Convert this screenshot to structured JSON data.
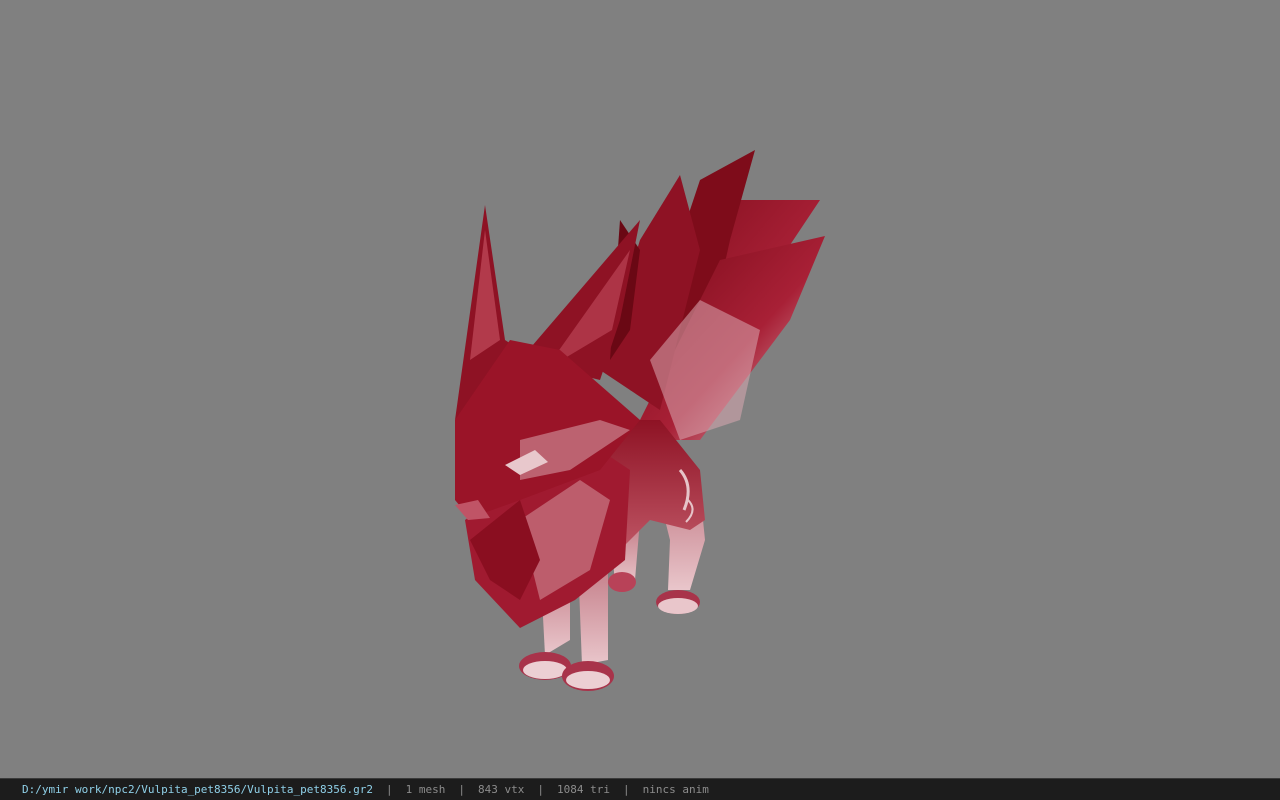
{
  "viewer": {
    "background_color": "#808080",
    "model_color": "#8b0f1e",
    "model_highlight_color": "#e8c8cc",
    "icon": "red-nine-tailed-fox-model"
  },
  "statusbar": {
    "file_path": "D:/ymir work/npc2/Vulpita_pet8356/Vulpita_pet8356.gr2",
    "separator": "|",
    "mesh_count": "1 mesh",
    "vertex_count": "843 vtx",
    "triangle_count": "1084 tri",
    "anim_status": "nincs anim"
  }
}
